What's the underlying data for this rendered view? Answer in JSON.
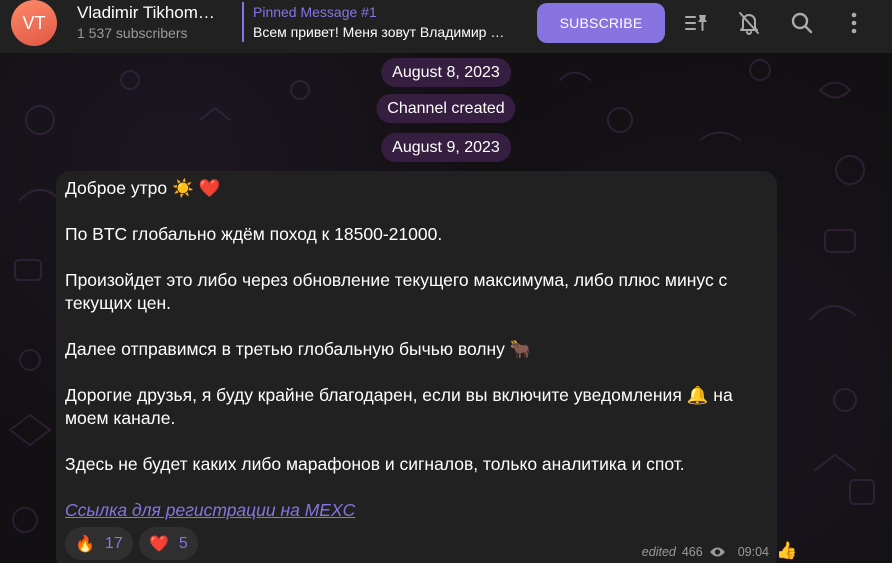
{
  "header": {
    "avatar_initials": "VT",
    "channel_name": "Vladimir Tikhomirov",
    "subscribers": "1 537 subscribers",
    "pinned_title": "Pinned Message #1",
    "pinned_text": "Всем привет! Меня зовут Владимир Тихомиров",
    "subscribe_label": "SUBSCRIBE",
    "icons": [
      "pinned-list-icon",
      "mute-bell-icon",
      "search-icon",
      "more-vertical-icon"
    ]
  },
  "dates": {
    "first": "August 8, 2023",
    "service": "Channel created",
    "second": "August 9, 2023"
  },
  "message": {
    "lines": [
      "Доброе утро ☀️ ❤️",
      "По BTC глобально ждём поход к 18500-21000.",
      "Произойдет это либо через обновление текущего максимума, либо плюс минус с текущих цен.",
      "Далее отправимся в третью глобальную бычью волну 🐂",
      "Дорогие друзья, я буду крайне благодарен, если вы включите уведомления 🔔  на моем канале.",
      "Здесь не будет каких либо марафонов и сигналов, только аналитика и спот."
    ],
    "link_text": "Ссылка для регистрации на MEXC",
    "reactions": [
      {
        "emoji": "🔥",
        "count": "17"
      },
      {
        "emoji": "❤️",
        "count": "5"
      }
    ],
    "edited_label": "edited",
    "views": "466",
    "time": "09:04",
    "quick_reaction": "👍"
  },
  "colors": {
    "accent": "#8774e1",
    "header_bg": "#212121",
    "bubble_bg": "#212121",
    "date_pill_bg": "#3a2044"
  }
}
